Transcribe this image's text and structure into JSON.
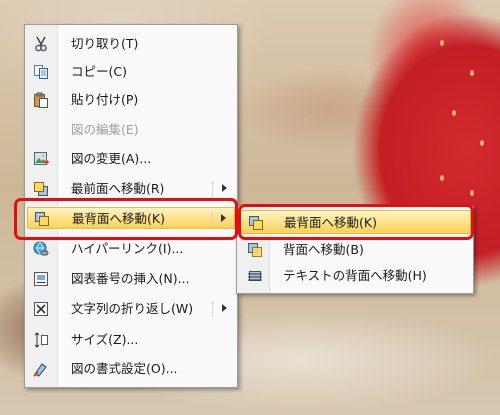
{
  "context_menu": {
    "items": [
      {
        "label": "切り取り(T)",
        "icon": "scissors-icon",
        "enabled": true
      },
      {
        "label": "コピー(C)",
        "icon": "copy-icon",
        "enabled": true
      },
      {
        "label": "貼り付け(P)",
        "icon": "paste-icon",
        "enabled": true
      },
      {
        "label": "図の編集(E)",
        "icon": "",
        "enabled": false
      },
      {
        "label": "図の変更(A)...",
        "icon": "change-picture-icon",
        "enabled": true
      },
      {
        "label": "最前面へ移動(R)",
        "icon": "bring-to-front-icon",
        "enabled": true,
        "submenu": true
      },
      {
        "label": "最背面へ移動(K)",
        "icon": "send-to-back-icon",
        "enabled": true,
        "submenu": true,
        "highlighted": true
      },
      {
        "label": "ハイパーリンク(I)...",
        "icon": "hyperlink-icon",
        "enabled": true
      },
      {
        "label": "図表番号の挿入(N)...",
        "icon": "insert-caption-icon",
        "enabled": true
      },
      {
        "label": "文字列の折り返し(W)",
        "icon": "text-wrapping-icon",
        "enabled": true,
        "submenu": true
      },
      {
        "label": "サイズ(Z)...",
        "icon": "size-icon",
        "enabled": true
      },
      {
        "label": "図の書式設定(O)...",
        "icon": "format-picture-icon",
        "enabled": true
      }
    ]
  },
  "submenu": {
    "items": [
      {
        "label": "最背面へ移動(K)",
        "icon": "send-to-back-icon",
        "highlighted": true
      },
      {
        "label": "背面へ移動(B)",
        "icon": "send-backward-icon",
        "highlighted": false
      },
      {
        "label": "テキストの背面へ移動(H)",
        "icon": "behind-text-icon",
        "highlighted": false
      }
    ]
  },
  "colors": {
    "highlight_outline": "#e01010",
    "hover_fill": "#ffd256"
  }
}
